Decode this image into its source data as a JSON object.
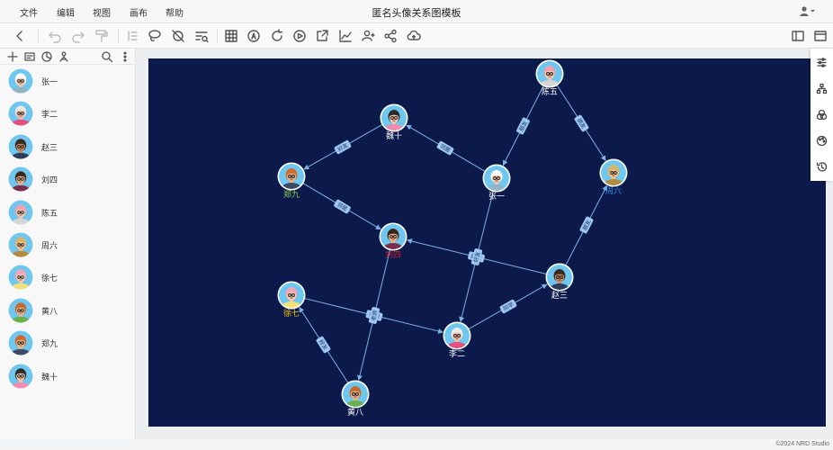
{
  "menu": {
    "file": "文件",
    "edit": "编辑",
    "view": "视图",
    "canvas": "画布",
    "help": "帮助"
  },
  "title": "匿名头像关系图模板",
  "toolbar_icons": [
    "back-icon",
    "undo-icon",
    "redo-icon",
    "format-painter-icon",
    "clear-format-icon",
    "lasso-icon",
    "hide-icon",
    "find-replace-icon",
    "table-icon",
    "auto-layout-icon",
    "refresh-icon",
    "play-icon",
    "export-icon",
    "chart-icon",
    "user-group-icon",
    "share-icon",
    "cloud-upload-icon",
    "panel-left-icon",
    "window-icon"
  ],
  "persons": [
    {
      "name": "张一",
      "bg": "#6fc7ef",
      "hair": "#ffffff",
      "skin": "#f2c6a8",
      "shirt": "#8fb5c9"
    },
    {
      "name": "李二",
      "bg": "#6fc7ef",
      "hair": "#e8e8e8",
      "skin": "#f1b9a6",
      "shirt": "#e44f7d"
    },
    {
      "name": "赵三",
      "bg": "#6fc7ef",
      "hair": "#3a2a1f",
      "skin": "#c58b63",
      "shirt": "#2d3e5c"
    },
    {
      "name": "刘四",
      "bg": "#6fc7ef",
      "hair": "#3b2519",
      "skin": "#e9b48f",
      "shirt": "#7c2f4d"
    },
    {
      "name": "陈五",
      "bg": "#6fc7ef",
      "hair": "#f0a0b0",
      "skin": "#f2c6a8",
      "shirt": "#d6d6d6"
    },
    {
      "name": "周六",
      "bg": "#6fc7ef",
      "hair": "#d7b46a",
      "skin": "#eec08b",
      "shirt": "#b48a3c"
    },
    {
      "name": "徐七",
      "bg": "#6fc7ef",
      "hair": "#f2a7b8",
      "skin": "#f4cbb0",
      "shirt": "#f4e07a"
    },
    {
      "name": "黄八",
      "bg": "#6fc7ef",
      "hair": "#c66a2c",
      "skin": "#eab48a",
      "shirt": "#6ab04c"
    },
    {
      "name": "郑九",
      "bg": "#6fc7ef",
      "hair": "#d2692c",
      "skin": "#eab48a",
      "shirt": "#3c4a64"
    },
    {
      "name": "魏十",
      "bg": "#6fc7ef",
      "hair": "#2a2a2a",
      "skin": "#f2c6a8",
      "shirt": "#f08cb0"
    }
  ],
  "graph": {
    "nodes": [
      {
        "id": "zhang1",
        "name": "张一",
        "avatar": 0,
        "label_color": "#ffffff"
      },
      {
        "id": "li2",
        "name": "李二",
        "avatar": 1,
        "label_color": "#ffffff"
      },
      {
        "id": "zhao3",
        "name": "赵三",
        "avatar": 2,
        "label_color": "#ffffff"
      },
      {
        "id": "liu4",
        "name": "刘四",
        "avatar": 3,
        "label_color": "#d4202c"
      },
      {
        "id": "chen5",
        "name": "陈五",
        "avatar": 4,
        "label_color": "#ffffff"
      },
      {
        "id": "zhou6",
        "name": "周六",
        "avatar": 5,
        "label_color": "#2f8de0"
      },
      {
        "id": "xu7",
        "name": "徐七",
        "avatar": 6,
        "label_color": "#f2c200"
      },
      {
        "id": "huang8",
        "name": "黄八",
        "avatar": 7,
        "label_color": "#ffffff"
      },
      {
        "id": "zheng9",
        "name": "郑九",
        "avatar": 8,
        "label_color": "#8fd14f"
      },
      {
        "id": "wei10",
        "name": "魏十",
        "avatar": 9,
        "label_color": "#ffffff"
      }
    ],
    "edges": [
      {
        "from": "chen5",
        "to": "zhang1",
        "label": "朋友"
      },
      {
        "from": "chen5",
        "to": "zhou6",
        "label": "朋友"
      },
      {
        "from": "zhang1",
        "to": "wei10",
        "label": "邻居"
      },
      {
        "from": "wei10",
        "to": "zheng9",
        "label": "好友"
      },
      {
        "from": "zheng9",
        "to": "liu4",
        "label": "邻居"
      },
      {
        "from": "zhao3",
        "to": "liu4",
        "label": "好友"
      },
      {
        "from": "zhang1",
        "to": "li2",
        "label": "好友"
      },
      {
        "from": "zhao3",
        "to": "zhou6",
        "label": "朋友"
      },
      {
        "from": "li2",
        "to": "zhao3",
        "label": "同学"
      },
      {
        "from": "xu7",
        "to": "li2",
        "label": "老师"
      },
      {
        "from": "liu4",
        "to": "huang8",
        "label": "老师"
      },
      {
        "from": "huang8",
        "to": "xu7",
        "label": "好友"
      }
    ],
    "colors": {
      "background": "#0b1a4b",
      "edge": "#7fb0e6",
      "edge_label_bg": "#9cc8ef",
      "node_ring": "#ffffff"
    }
  },
  "right_panel_icons": [
    "adjust-icon",
    "hierarchy-icon",
    "color-circles-icon",
    "palette-icon",
    "history-icon"
  ],
  "copyright": "©2024 NRD Studio"
}
